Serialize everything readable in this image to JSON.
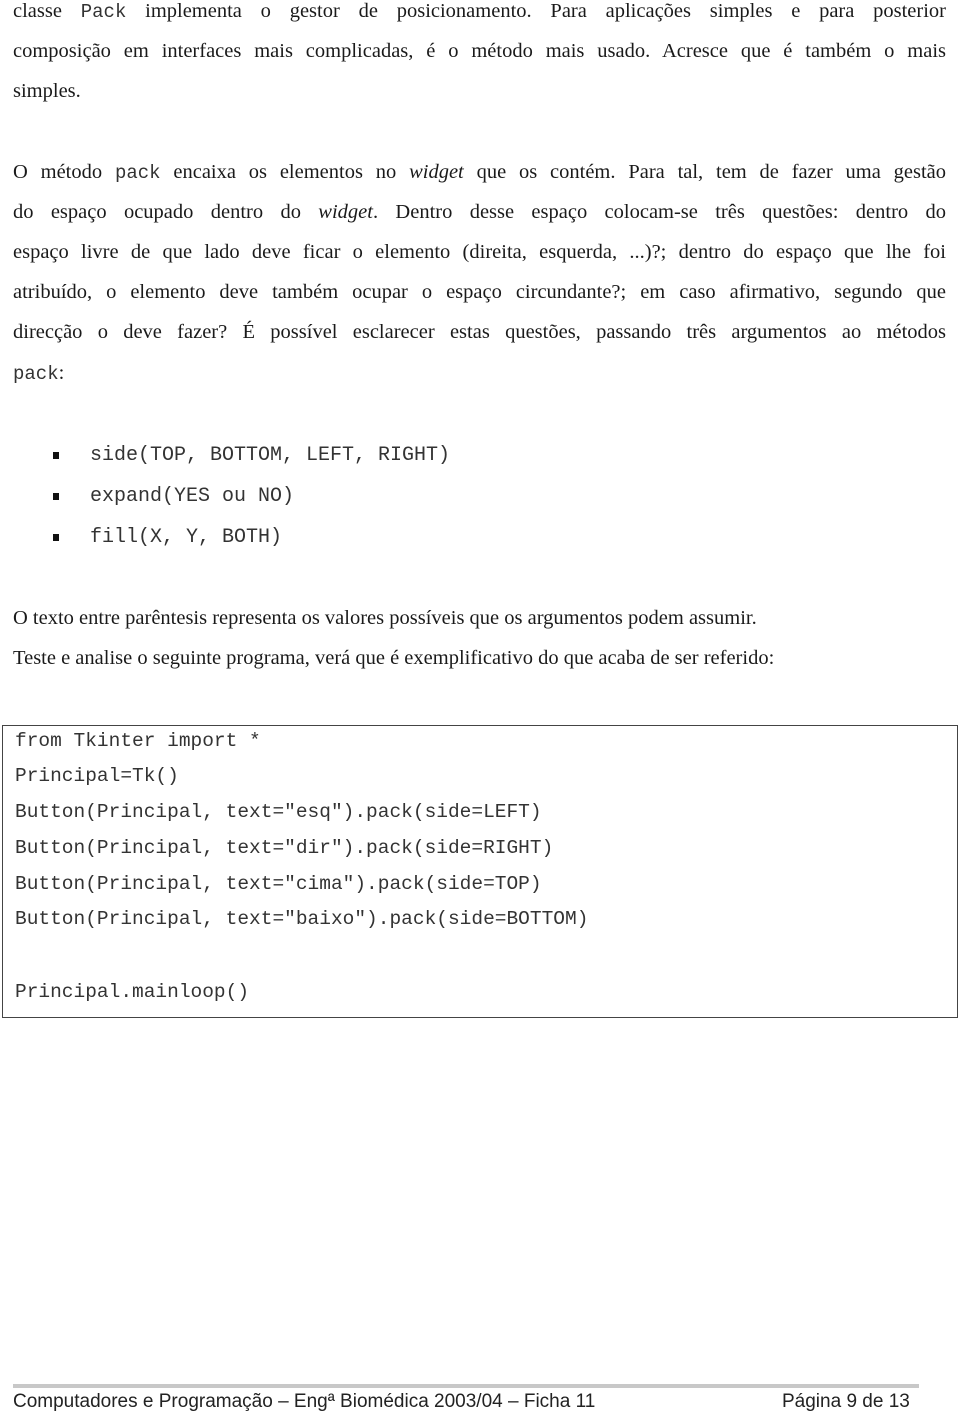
{
  "paragraphs": [
    {
      "lines": [
        [
          {
            "t": "classe ",
            "s": ""
          },
          {
            "t": "Pack",
            "s": "code"
          },
          {
            "t": " implementa o gestor de posicionamento. Para aplicações simples e para posterior",
            "s": ""
          }
        ],
        [
          {
            "t": "composição em interfaces mais complicadas, é o método mais usado. Acresce que é também o mais",
            "s": ""
          }
        ],
        [
          {
            "t": "simples.",
            "s": ""
          }
        ]
      ]
    },
    {
      "lines": [
        [
          {
            "t": "O método ",
            "s": ""
          },
          {
            "t": "pack",
            "s": "code"
          },
          {
            "t": " encaixa os elementos no ",
            "s": ""
          },
          {
            "t": "widget",
            "s": "it"
          },
          {
            "t": " que os contém. Para tal, tem de fazer uma gestão",
            "s": ""
          }
        ],
        [
          {
            "t": "do espaço ocupado dentro do ",
            "s": ""
          },
          {
            "t": "widget",
            "s": "it"
          },
          {
            "t": ". Dentro desse espaço colocam-se três questões: dentro do",
            "s": ""
          }
        ],
        [
          {
            "t": "espaço livre de que lado deve ficar o elemento (direita, esquerda, ...)?; dentro do espaço que lhe foi",
            "s": ""
          }
        ],
        [
          {
            "t": "atribuído, o elemento deve também ocupar o espaço circundante?; em caso afirmativo, segundo que",
            "s": ""
          }
        ],
        [
          {
            "t": "direcção o deve fazer? É possível esclarecer estas questões, passando três argumentos ao métodos",
            "s": ""
          }
        ],
        [
          {
            "t": "pack",
            "s": "code"
          },
          {
            "t": ":",
            "s": ""
          }
        ]
      ]
    },
    {
      "lines": [
        [
          {
            "t": "O texto entre parêntesis representa os valores possíveis que os argumentos podem assumir.",
            "s": ""
          }
        ],
        [
          {
            "t": "Teste e analise o seguinte programa, verá que é exemplificativo do que acaba de ser referido:",
            "s": ""
          }
        ]
      ]
    }
  ],
  "bullets": [
    "side(TOP, BOTTOM, LEFT, RIGHT)",
    "expand(YES ou NO)",
    "fill(X, Y, BOTH)"
  ],
  "code": [
    "from Tkinter import *",
    "Principal=Tk()",
    "Button(Principal, text=\"esq\").pack(side=LEFT)",
    "Button(Principal, text=\"dir\").pack(side=RIGHT)",
    "Button(Principal, text=\"cima\").pack(side=TOP)",
    "Button(Principal, text=\"baixo\").pack(side=BOTTOM)",
    "",
    "Principal.mainloop()"
  ],
  "footer": {
    "left": "Computadores e Programação – Engª Biomédica 2003/04 – Ficha 11",
    "right": "Página 9 de 13"
  }
}
